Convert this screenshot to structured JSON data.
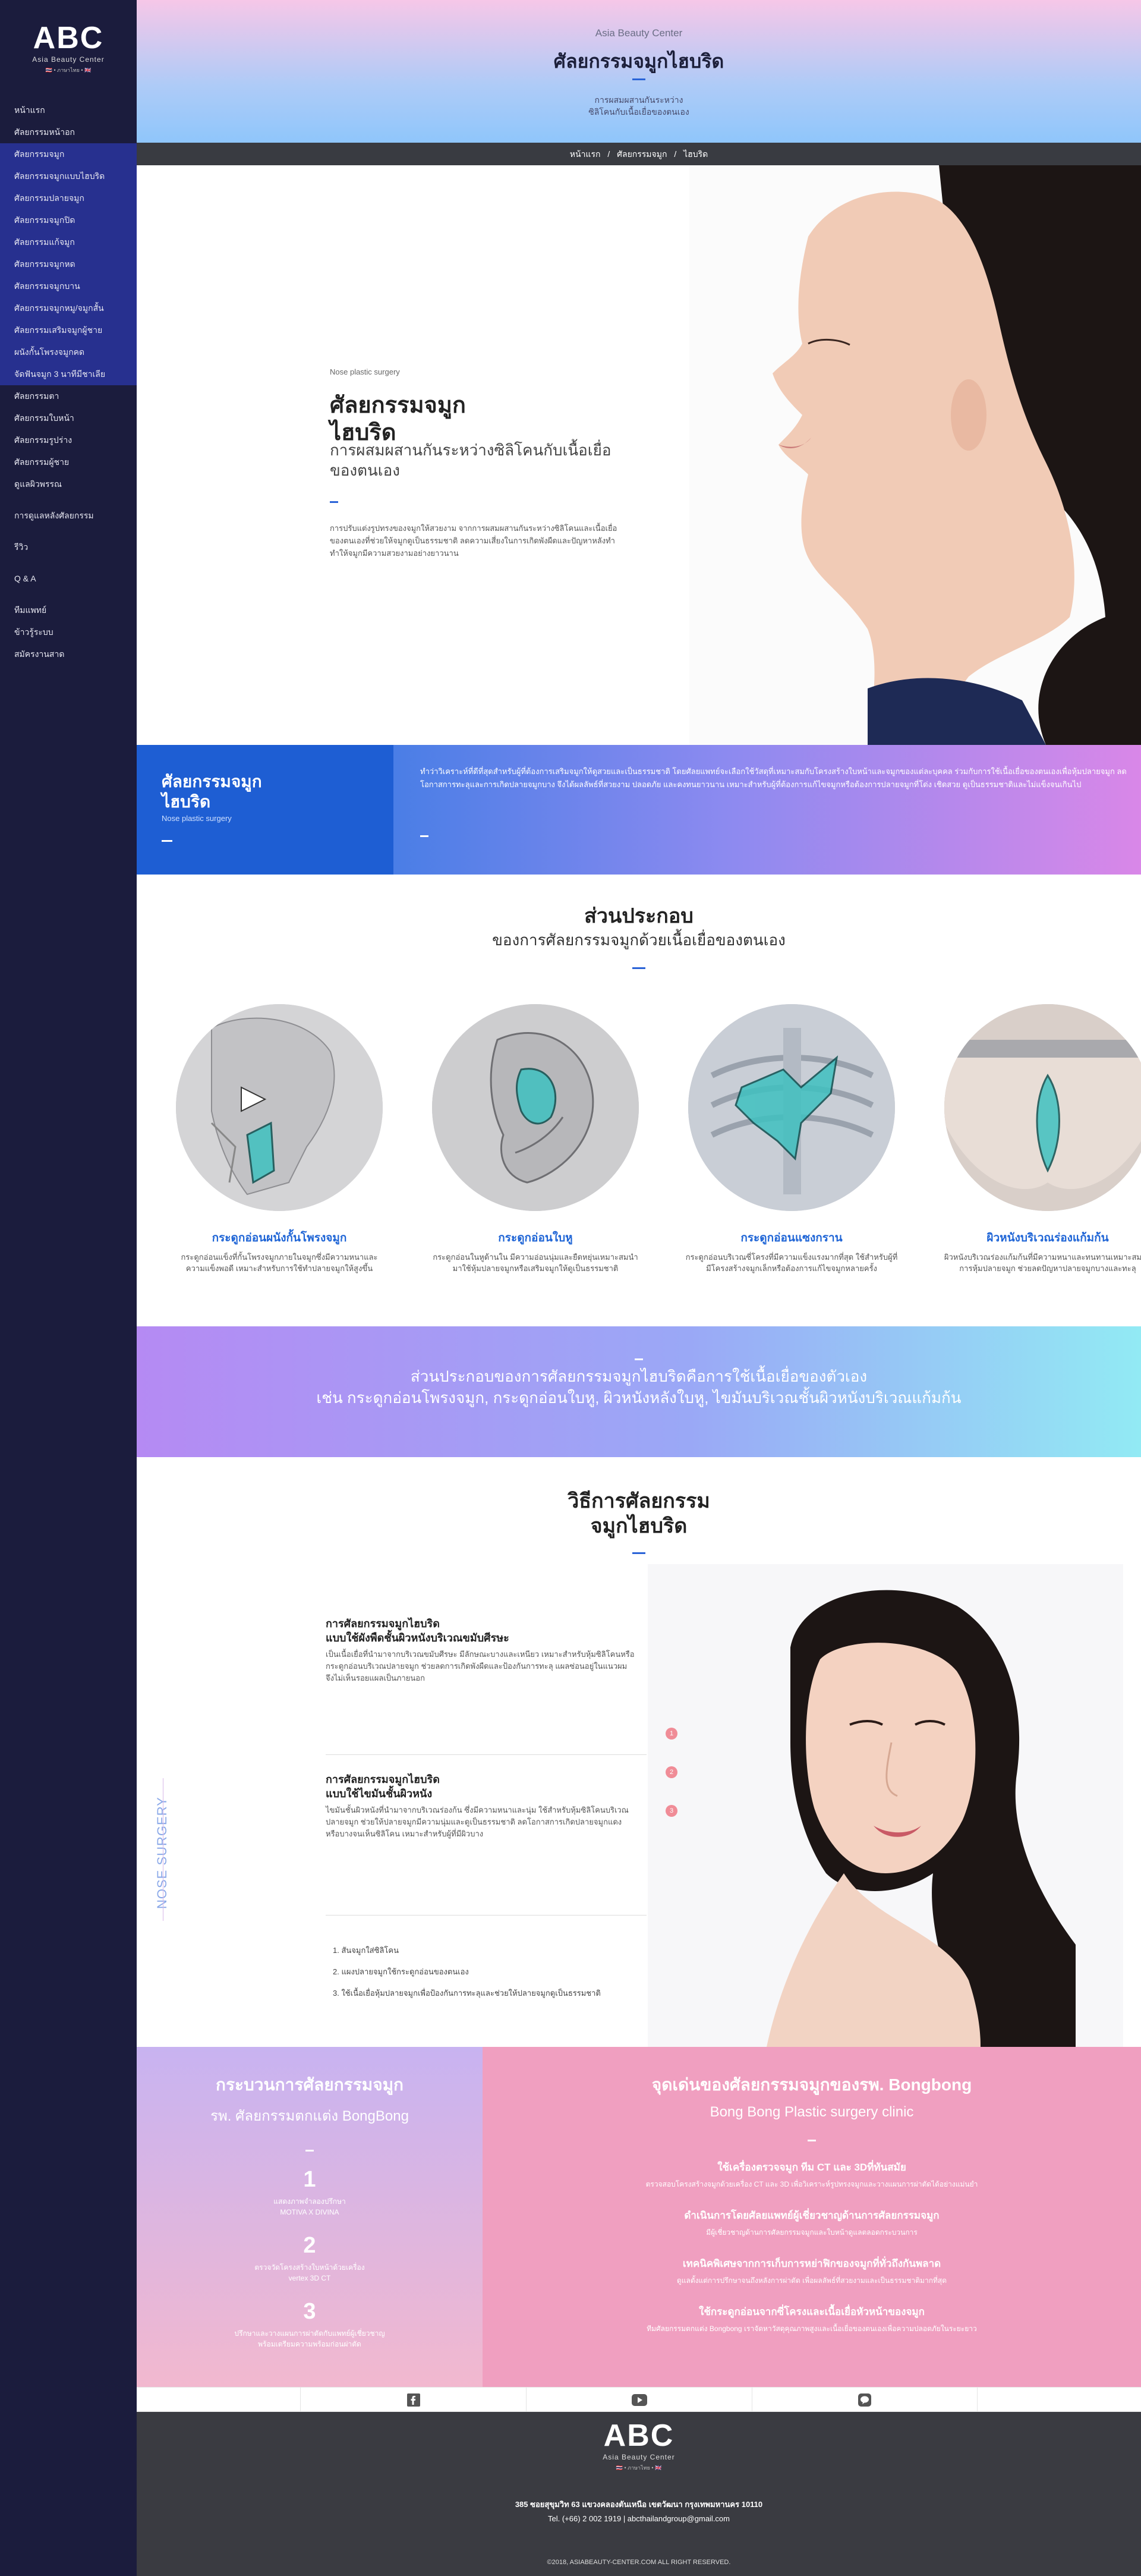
{
  "logo": {
    "abc": "ABC",
    "sub": "Asia Beauty Center",
    "flags": "🇹🇭 • ภาษาไทย • 🇬🇧"
  },
  "nav": {
    "items": [
      {
        "label": "หน้าแรก",
        "style": "plain"
      },
      {
        "label": "ศัลยกรรมหน้าอก",
        "style": "plain"
      },
      {
        "label": "ศัลยกรรมจมูก",
        "style": "blue"
      },
      {
        "label": "ศัลยกรรมจมูกแบบไฮบริด",
        "style": "blue"
      },
      {
        "label": "ศัลยกรรมปลายจมูก",
        "style": "blue"
      },
      {
        "label": "ศัลยกรรมจมูกปิด",
        "style": "blue"
      },
      {
        "label": "ศัลยกรรมแก้จมูก",
        "style": "blue"
      },
      {
        "label": "ศัลยกรรมจมูกหด",
        "style": "blue"
      },
      {
        "label": "ศัลยกรรมจมูกบาน",
        "style": "blue"
      },
      {
        "label": "ศัลยกรรมจมูกหมู/จมูกสั้น",
        "style": "blue"
      },
      {
        "label": "ศัลยกรรมเสริมจมูกผู้ชาย",
        "style": "blue"
      },
      {
        "label": "ผนังกั้นโพรงจมูกคด",
        "style": "blue"
      },
      {
        "label": "จัดฟันจมูก 3 นาทีมีชาเลีย",
        "style": "blue"
      },
      {
        "label": "ศัลยกรรมตา",
        "style": "plain"
      },
      {
        "label": "ศัลยกรรมใบหน้า",
        "style": "plain"
      },
      {
        "label": "ศัลยกรรมรูปร่าง",
        "style": "plain"
      },
      {
        "label": "ศัลยกรรมผู้ชาย",
        "style": "plain"
      },
      {
        "label": "ดูแลผิวพรรณ",
        "style": "plain"
      },
      {
        "label": "การดูแลหลังศัลยกรรม",
        "style": "sep"
      },
      {
        "label": "รีวิว",
        "style": "sep"
      },
      {
        "label": "Q & A",
        "style": "sep"
      },
      {
        "label": "ทีมแพทย์",
        "style": "sep"
      },
      {
        "label": "ข้าวรู้ระบบ",
        "style": "plain"
      },
      {
        "label": "สมัครงานสาด",
        "style": "plain"
      }
    ]
  },
  "hero": {
    "brand": "Asia Beauty Center",
    "title": "ศัลยกรรมจมูกไฮบริด",
    "sub1": "การผสมผสานกันระหว่าง",
    "sub2": "ซิลิโคนกับเนื้อเยื่อของตนเอง"
  },
  "breadcrumb": [
    "หน้าแรก",
    "/",
    "ศัลยกรรมจมูก",
    "/",
    "ไฮบริด"
  ],
  "intro": {
    "en": "Nose plastic surgery",
    "title1": "ศัลยกรรมจมูก",
    "title2": "ไฮบริด",
    "subtitle": "การผสมผสานกันระหว่างซิลิโคนกับเนื้อเยื่อของตนเอง",
    "text": "การปรับแต่งรูปทรงของจมูกให้สวยงาม จากการผสมผสานกันระหว่างซิลิโคนและเนื้อเยื่อของตนเองที่ช่วยให้จมูกดูเป็นธรรมชาติ ลดความเสี่ยงในการเกิดพังผืดและปัญหาหลังทำ ทำให้จมูกมีความสวยงามอย่างยาวนาน"
  },
  "band1": {
    "title1": "ศัลยกรรมจมูก",
    "title2": "ไฮบริด",
    "en": "Nose plastic surgery",
    "text": "ทำว่าวิเคราะห์ที่ดีที่สุดสำหรับผู้ที่ต้องการเสริมจมูกให้ดูสวยและเป็นธรรมชาติ โดยศัลยแพทย์จะเลือกใช้วัสดุที่เหมาะสมกับโครงสร้างใบหน้าและจมูกของแต่ละบุคคล ร่วมกับการใช้เนื้อเยื่อของตนเองเพื่อหุ้มปลายจมูก ลดโอกาสการทะลุและการเกิดปลายจมูกบาง จึงได้ผลลัพธ์ที่สวยงาม ปลอดภัย และคงทนยาวนาน เหมาะสำหรับผู้ที่ต้องการแก้ไขจมูกหรือต้องการปลายจมูกที่โด่ง เชิดสวย ดูเป็นธรรมชาติและไม่แข็งจนเกินไป"
  },
  "components": {
    "title": "ส่วนประกอบ",
    "subtitle": "ของการศัลยกรรมจมูกด้วยเนื้อเยื่อของตนเอง",
    "cards": [
      {
        "title": "กระดูกอ่อนผนังกั้นโพรงจมูก",
        "text": "กระดูกอ่อนแข็งที่กั้นโพรงจมูกภายในจมูกซึ่งมีความหนาและความแข็งพอดี เหมาะสำหรับการใช้ทำปลายจมูกให้สูงขึ้น"
      },
      {
        "title": "กระดูกอ่อนใบหู",
        "text": "กระดูกอ่อนในหูด้านใน มีความอ่อนนุ่มและยืดหยุ่นเหมาะสมนำมาใช้หุ้มปลายจมูกหรือเสริมจมูกให้ดูเป็นธรรมชาติ"
      },
      {
        "title": "กระดูกอ่อนแซงกราน",
        "text": "กระดูกอ่อนบริเวณซี่โครงที่มีความแข็งแรงมากที่สุด ใช้สำหรับผู้ที่มีโครงสร้างจมูกเล็กหรือต้องการแก้ไขจมูกหลายครั้ง"
      },
      {
        "title": "ผิวหนังบริเวณร่องแก้มก้น",
        "text": "ผิวหนังบริเวณร่องแก้มก้นที่มีความหนาและทนทานเหมาะสมกับการหุ้มปลายจมูก ช่วยลดปัญหาปลายจมูกบางและทะลุ"
      }
    ]
  },
  "band2": {
    "line1": "ส่วนประกอบของการศัลยกรรมจมูกไฮบริดคือการใช้เนื้อเยื่อของตัวเอง",
    "line2": "เช่น กระดูกอ่อนโพรงจมูก, กระดูกอ่อนใบหู, ผิวหนังหลังใบหู, ไขมันบริเวณชั้นผิวหนังบริเวณแก้มก้น"
  },
  "method": {
    "title1": "วิธีการศัลยกรรม",
    "title2": "จมูกไฮบริด",
    "vertical": "NOSE SURGERY",
    "blocks": [
      {
        "h1": "การศัลยกรรมจมูกไฮบริด",
        "h2": "แบบใช้ผังพืดชั้นผิวหนังบริเวณขมับศีรษะ",
        "text": "เป็นเนื้อเยื่อที่นำมาจากบริเวณขมับศีรษะ มีลักษณะบางและเหนียว เหมาะสำหรับหุ้มซิลิโคนหรือกระดูกอ่อนบริเวณปลายจมูก ช่วยลดการเกิดพังผืดและป้องกันการทะลุ แผลซ่อนอยู่ในแนวผม จึงไม่เห็นรอยแผลเป็นภายนอก"
      },
      {
        "h1": "การศัลยกรรมจมูกไฮบริด",
        "h2": "แบบใช้ไขมันชั้นผิวหนัง",
        "text": "ไขมันชั้นผิวหนังที่นำมาจากบริเวณร่องก้น ซึ่งมีความหนาและนุ่ม ใช้สำหรับหุ้มซิลิโคนบริเวณปลายจมูก ช่วยให้ปลายจมูกมีความนุ่มและดูเป็นธรรมชาติ ลดโอกาสการเกิดปลายจมูกแดงหรือบางจนเห็นซิลิโคน เหมาะสำหรับผู้ที่มีผิวบาง"
      }
    ],
    "list": [
      "1. สันจมูกใส่ซิลิโคน",
      "2. แผงปลายจมูกใช้กระดูกอ่อนของตนเอง",
      "3. ใช้เนื้อเยื่อหุ้มปลายจมูกเพื่อป้องกันการทะลุและช่วยให้ปลายจมูกดูเป็นธรรมชาติ"
    ],
    "dots": [
      "1",
      "2",
      "3"
    ]
  },
  "process": {
    "title": "กระบวนการศัลยกรรมจมูก",
    "subtitle": "รพ. ศัลยกรรมตกแต่ง BongBong",
    "steps": [
      {
        "n": "1",
        "text": "แสดงภาพจำลองปรึกษา\nMOTIVA X DIVINA"
      },
      {
        "n": "2",
        "text": "ตรวจวัดโครงสร้างใบหน้าด้วยเครื่อง\nvertex 3D CT"
      },
      {
        "n": "3",
        "text": "ปรึกษาและวางแผนการผ่าตัดกับแพทย์ผู้เชี่ยวชาญ\nพร้อมเตรียมความพร้อมก่อนผ่าตัด"
      }
    ]
  },
  "highlights": {
    "title": "จุดเด่นของศัลยกรรมจมูกของรพ. Bongbong",
    "subtitle": "Bong Bong Plastic surgery clinic",
    "items": [
      {
        "h": "ใช้เครื่องตรวจจมูก ทีม CT และ 3Dที่ทันสมัย",
        "t": "ตรวจสอบโครงสร้างจมูกด้วยเครื่อง CT และ 3D เพื่อวิเคราะห์รูปทรงจมูกและวางแผนการผ่าตัดได้อย่างแม่นยำ"
      },
      {
        "h": "ดำเนินการโดยศัลยแพทย์ผู้เชี่ยวชาญด้านการศัลยกรรมจมูก",
        "t": "มีผู้เชี่ยวชาญด้านการศัลยกรรมจมูกและใบหน้าดูแลตลอดกระบวนการ"
      },
      {
        "h": "เทคนิคพิเศษจากการเก็บการหย่าฟิกของจมูกที่ทั่วถึงกันพลาด",
        "t": "ดูแลตั้งแต่การปรึกษาจนถึงหลังการผ่าตัด เพื่อผลลัพธ์ที่สวยงามและเป็นธรรมชาติมากที่สุด"
      },
      {
        "h": "ใช้กระดูกอ่อนจากซี่โครงและเนื้อเยื่อหัวหน้าของจมูก",
        "t": "ทีมศัลยกรรมตกแต่ง Bongbong เราจัดหาวัสดุคุณภาพสูงและเนื้อเยื่อของตนเองเพื่อความปลอดภัยในระยะยาว"
      }
    ]
  },
  "social": {
    "icons": [
      "facebook-icon",
      "youtube-icon",
      "line-icon"
    ]
  },
  "footer": {
    "abc": "ABC",
    "sub": "Asia Beauty Center",
    "flags": "🇹🇭 • ภาษาไทย • 🇬🇧",
    "address": "385 ซอยสุขุมวิท 63 แขวงคลองตันเหนือ เขตวัฒนา กรุงเทพมหานคร 10110",
    "tel": "Tel. (+66) 2 002 1919 | abcthailandgroup@gmail.com",
    "copyright": "©2018, ASIABEAUTY-CENTER.COM ALL RIGHT RESERVED."
  },
  "colors": {
    "sidebar": "#1b1c3d",
    "active": "#27308f",
    "accent": "#2a63d7",
    "pink": "#f09fc0"
  }
}
